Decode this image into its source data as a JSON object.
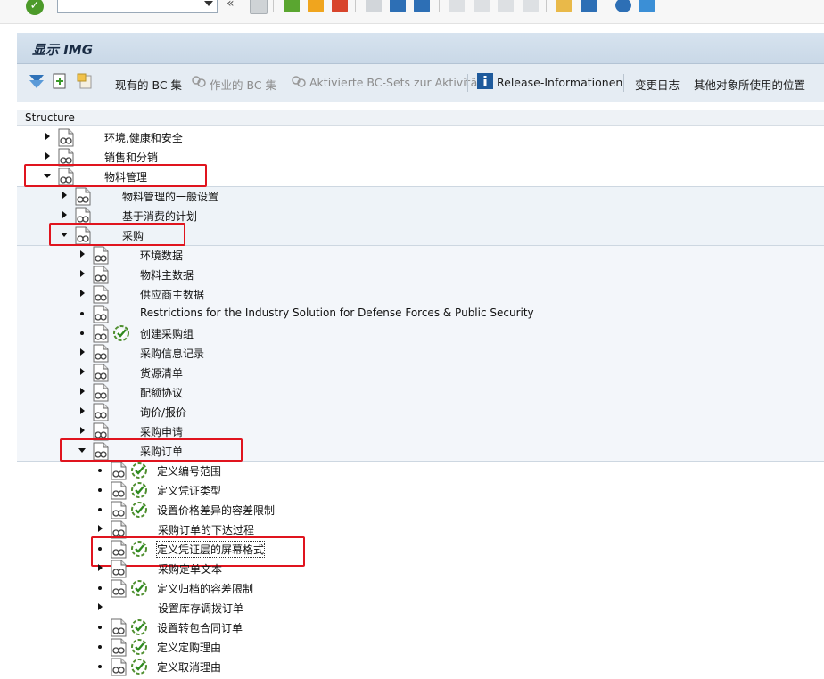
{
  "window": {
    "title": "显示 IMG"
  },
  "app_toolbar": {
    "btn_existing_bc": "现有的 BC 集",
    "btn_bc_for_activity": "作业的 BC 集",
    "btn_activated_bc": "Aktivierte BC-Sets zur Aktivität",
    "btn_release_info": "Release-Informationen",
    "btn_change_log": "变更日志",
    "btn_where_used": "其他对象所使用的位置"
  },
  "tree": {
    "header": "Structure",
    "nodes": [
      {
        "label": "环境,健康和安全",
        "state": "collapsed",
        "level": 1
      },
      {
        "label": "销售和分销",
        "state": "collapsed",
        "level": 1
      },
      {
        "label": "物料管理",
        "state": "expanded",
        "level": 1,
        "highlighted": true
      },
      {
        "label": "物料管理的一般设置",
        "state": "collapsed",
        "level": 2
      },
      {
        "label": "基于消费的计划",
        "state": "collapsed",
        "level": 2
      },
      {
        "label": "采购",
        "state": "expanded",
        "level": 2,
        "highlighted": true
      },
      {
        "label": "环境数据",
        "state": "collapsed",
        "level": 3
      },
      {
        "label": "物料主数据",
        "state": "collapsed",
        "level": 3
      },
      {
        "label": "供应商主数据",
        "state": "collapsed",
        "level": 3
      },
      {
        "label": "Restrictions for the Industry Solution for Defense Forces & Public Security",
        "state": "leaf",
        "level": 3
      },
      {
        "label": "创建采购组",
        "state": "leaf",
        "level": 3,
        "has_activity": true
      },
      {
        "label": "采购信息记录",
        "state": "collapsed",
        "level": 3
      },
      {
        "label": "货源清单",
        "state": "collapsed",
        "level": 3
      },
      {
        "label": "配额协议",
        "state": "collapsed",
        "level": 3
      },
      {
        "label": "询价/报价",
        "state": "collapsed",
        "level": 3
      },
      {
        "label": "采购申请",
        "state": "collapsed",
        "level": 3
      },
      {
        "label": "采购订单",
        "state": "expanded",
        "level": 3,
        "highlighted": true
      },
      {
        "label": "定义编号范围",
        "state": "leaf",
        "level": 4,
        "has_activity": true
      },
      {
        "label": "定义凭证类型",
        "state": "leaf",
        "level": 4,
        "has_activity": true
      },
      {
        "label": "设置价格差异的容差限制",
        "state": "leaf",
        "level": 4,
        "has_activity": true
      },
      {
        "label": "采购订单的下达过程",
        "state": "collapsed",
        "level": 4
      },
      {
        "label": "定义凭证层的屏幕格式",
        "state": "leaf",
        "level": 4,
        "has_activity": true,
        "highlighted": true,
        "selected": true
      },
      {
        "label": "采购定单文本",
        "state": "collapsed",
        "level": 4
      },
      {
        "label": "定义归档的容差限制",
        "state": "leaf",
        "level": 4,
        "has_activity": true
      },
      {
        "label": "设置库存调拨订单",
        "state": "collapsed",
        "level": 4,
        "no_doc_icon": true
      },
      {
        "label": "设置转包合同订单",
        "state": "leaf",
        "level": 4,
        "has_activity": true
      },
      {
        "label": "定义定购理由",
        "state": "leaf",
        "level": 4,
        "has_activity": true
      },
      {
        "label": "定义取消理由",
        "state": "leaf",
        "level": 4,
        "has_activity": true
      }
    ]
  },
  "colors": {
    "highlight_box": "#e0141e",
    "title_bar": "#d2dfec",
    "toolbar_bg": "#e5ecf3",
    "expanded_band": "#e8eef4"
  }
}
